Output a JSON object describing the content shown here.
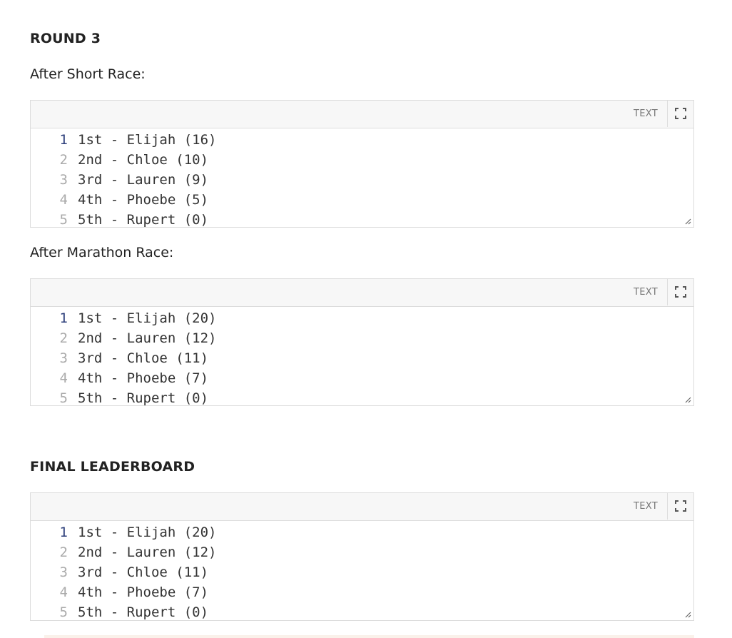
{
  "round3": {
    "heading": "ROUND 3",
    "short_race_label": "After Short Race:",
    "marathon_race_label": "After Marathon Race:"
  },
  "final": {
    "heading": "FINAL LEADERBOARD"
  },
  "codeblock_toolbar": {
    "language": "TEXT",
    "expand_icon": "expand-icon"
  },
  "short_race_lines": [
    {
      "num": "1",
      "text": "1st - Elijah (16)"
    },
    {
      "num": "2",
      "text": "2nd - Chloe (10)"
    },
    {
      "num": "3",
      "text": "3rd - Lauren (9)"
    },
    {
      "num": "4",
      "text": "4th - Phoebe (5)"
    },
    {
      "num": "5",
      "text": "5th - Rupert (0)"
    }
  ],
  "marathon_race_lines": [
    {
      "num": "1",
      "text": "1st - Elijah (20)"
    },
    {
      "num": "2",
      "text": "2nd - Lauren (12)"
    },
    {
      "num": "3",
      "text": "3rd - Chloe (11)"
    },
    {
      "num": "4",
      "text": "4th - Phoebe (7)"
    },
    {
      "num": "5",
      "text": "5th - Rupert (0)"
    }
  ],
  "final_lines": [
    {
      "num": "1",
      "text": "1st - Elijah (20)"
    },
    {
      "num": "2",
      "text": "2nd - Lauren (12)"
    },
    {
      "num": "3",
      "text": "3rd - Chloe (11)"
    },
    {
      "num": "4",
      "text": "4th - Phoebe (7)"
    },
    {
      "num": "5",
      "text": "5th - Rupert (0)"
    }
  ],
  "colors": {
    "toolbar_bg": "#f7f7f7",
    "border": "#dcdcdc",
    "first_line_number": "#2c3e7a",
    "line_number": "#aaaaaa"
  }
}
